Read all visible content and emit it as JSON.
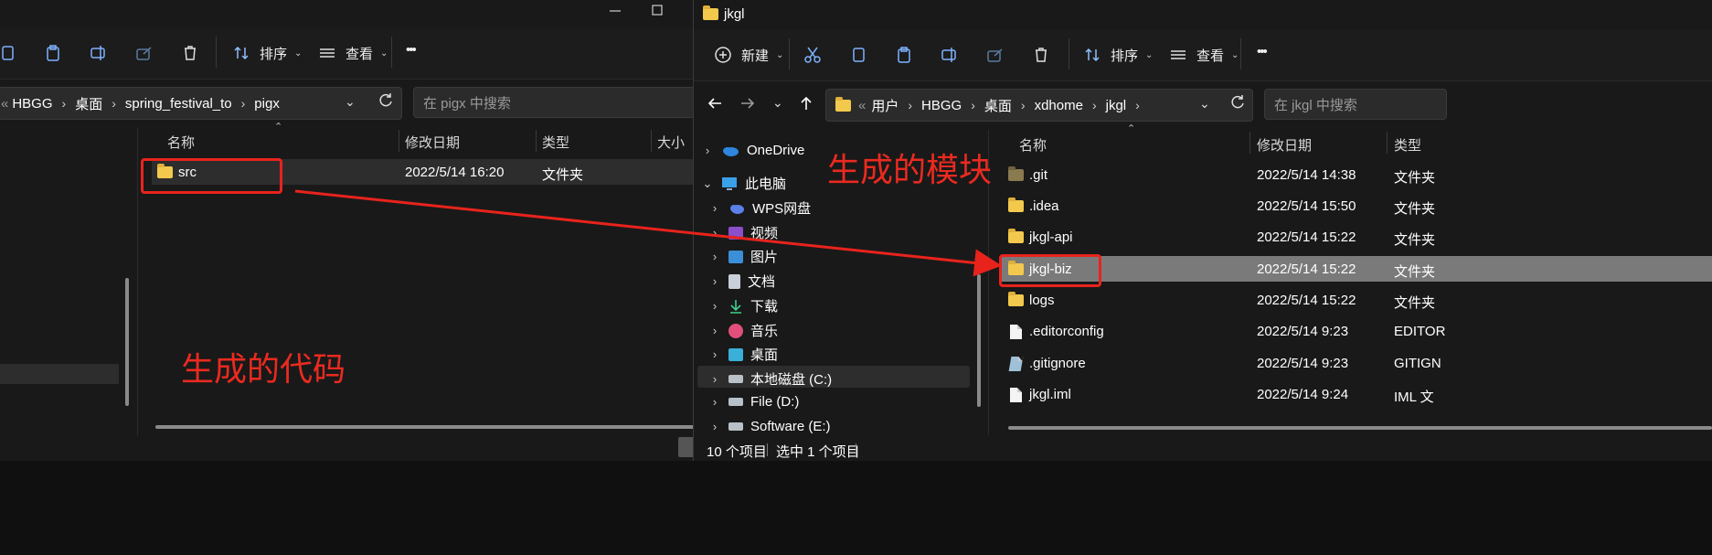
{
  "left_window": {
    "toolbar": {
      "sort_label": "排序",
      "view_label": "查看",
      "more_label": "•••"
    },
    "address": {
      "prefix": "«",
      "crumbs": [
        "HBGG",
        "桌面",
        "spring_festival_to",
        "pigx"
      ]
    },
    "search": {
      "placeholder": "在 pigx 中搜索"
    },
    "columns": [
      "名称",
      "修改日期",
      "类型",
      "大小"
    ],
    "files": [
      {
        "name": "src",
        "date": "2022/5/14 16:20",
        "type": "文件夹"
      }
    ]
  },
  "right_window": {
    "title": "jkgl",
    "toolbar": {
      "new_label": "新建",
      "sort_label": "排序",
      "view_label": "查看",
      "more_label": "•••"
    },
    "address": {
      "prefix": "«",
      "crumbs": [
        "用户",
        "HBGG",
        "桌面",
        "xdhome",
        "jkgl"
      ]
    },
    "search": {
      "placeholder": "在 jkgl 中搜索"
    },
    "nav": [
      {
        "label": "OneDrive",
        "icon": "onedrive-icon"
      },
      {
        "label": "此电脑",
        "icon": "pc-icon"
      },
      {
        "label": "WPS网盘",
        "icon": "wps-cloud-icon"
      },
      {
        "label": "视频",
        "icon": "video-icon"
      },
      {
        "label": "图片",
        "icon": "pictures-icon"
      },
      {
        "label": "文档",
        "icon": "documents-icon"
      },
      {
        "label": "下载",
        "icon": "download-icon"
      },
      {
        "label": "音乐",
        "icon": "music-icon"
      },
      {
        "label": "桌面",
        "icon": "desktop-icon"
      },
      {
        "label": "本地磁盘 (C:)",
        "icon": "drive-icon"
      },
      {
        "label": "File (D:)",
        "icon": "drive-icon"
      },
      {
        "label": "Software (E:)",
        "icon": "drive-icon"
      }
    ],
    "columns": [
      "名称",
      "修改日期",
      "类型"
    ],
    "files": [
      {
        "name": ".git",
        "date": "2022/5/14 14:38",
        "type": "文件夹",
        "icon": "folder-dim"
      },
      {
        "name": ".idea",
        "date": "2022/5/14 15:50",
        "type": "文件夹",
        "icon": "folder"
      },
      {
        "name": "jkgl-api",
        "date": "2022/5/14 15:22",
        "type": "文件夹",
        "icon": "folder"
      },
      {
        "name": "jkgl-biz",
        "date": "2022/5/14 15:22",
        "type": "文件夹",
        "icon": "folder"
      },
      {
        "name": "logs",
        "date": "2022/5/14 15:22",
        "type": "文件夹",
        "icon": "folder"
      },
      {
        "name": ".editorconfig",
        "date": "2022/5/14 9:23",
        "type": "EDITOR",
        "icon": "file"
      },
      {
        "name": ".gitignore",
        "date": "2022/5/14 9:23",
        "type": "GITIGN",
        "icon": "file-gitignore"
      },
      {
        "name": "jkgl.iml",
        "date": "2022/5/14 9:24",
        "type": "IML 文",
        "icon": "file"
      }
    ],
    "status": {
      "count": "10 个项目",
      "selected": "选中 1 个项目"
    }
  },
  "annotations": {
    "left_text": "生成的代码",
    "right_text": "生成的模块"
  },
  "colors": {
    "annotation_red": "#e8231c",
    "selection_gray": "#7a7a7a",
    "folder_yellow": "#f2c94c"
  }
}
